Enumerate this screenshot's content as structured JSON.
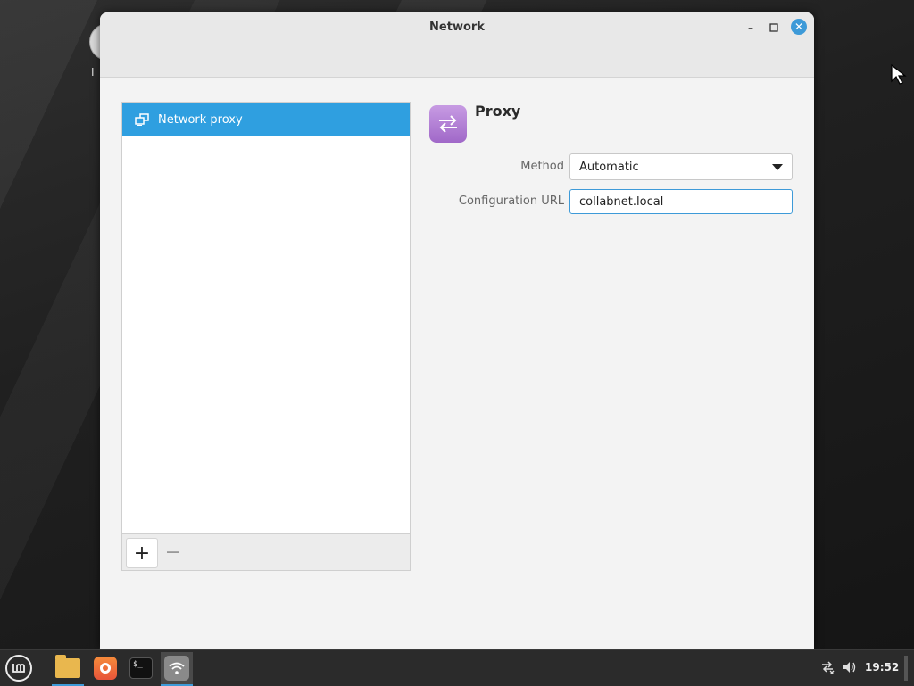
{
  "desktop": {
    "icon_label": "I"
  },
  "window": {
    "title": "Network",
    "controls": {
      "minimize": "–",
      "maximize": "□",
      "close": "✕"
    }
  },
  "sidebar": {
    "items": [
      {
        "label": "Network proxy",
        "icon": "network-proxy-icon",
        "selected": true
      }
    ],
    "toolbar": {
      "add_label": "+",
      "remove_label": "−"
    }
  },
  "proxy": {
    "title": "Proxy",
    "icon": "proxy-arrows-icon",
    "method_label": "Method",
    "method_value": "Automatic",
    "config_url_label": "Configuration URL",
    "config_url_value": "collabnet.local"
  },
  "taskbar": {
    "menu_icon": "mint-menu-icon",
    "launchers": [
      "files-icon",
      "firefox-icon",
      "terminal-icon",
      "network-settings-icon"
    ],
    "terminal_glyph": "$_",
    "tray": {
      "network_icon": "network-disconnected-icon",
      "volume_icon": "volume-icon"
    },
    "clock": "19:52"
  },
  "colors": {
    "accent": "#2f9fe0",
    "close_button": "#3d9ad8",
    "proxy_icon": "#b07fd6"
  }
}
